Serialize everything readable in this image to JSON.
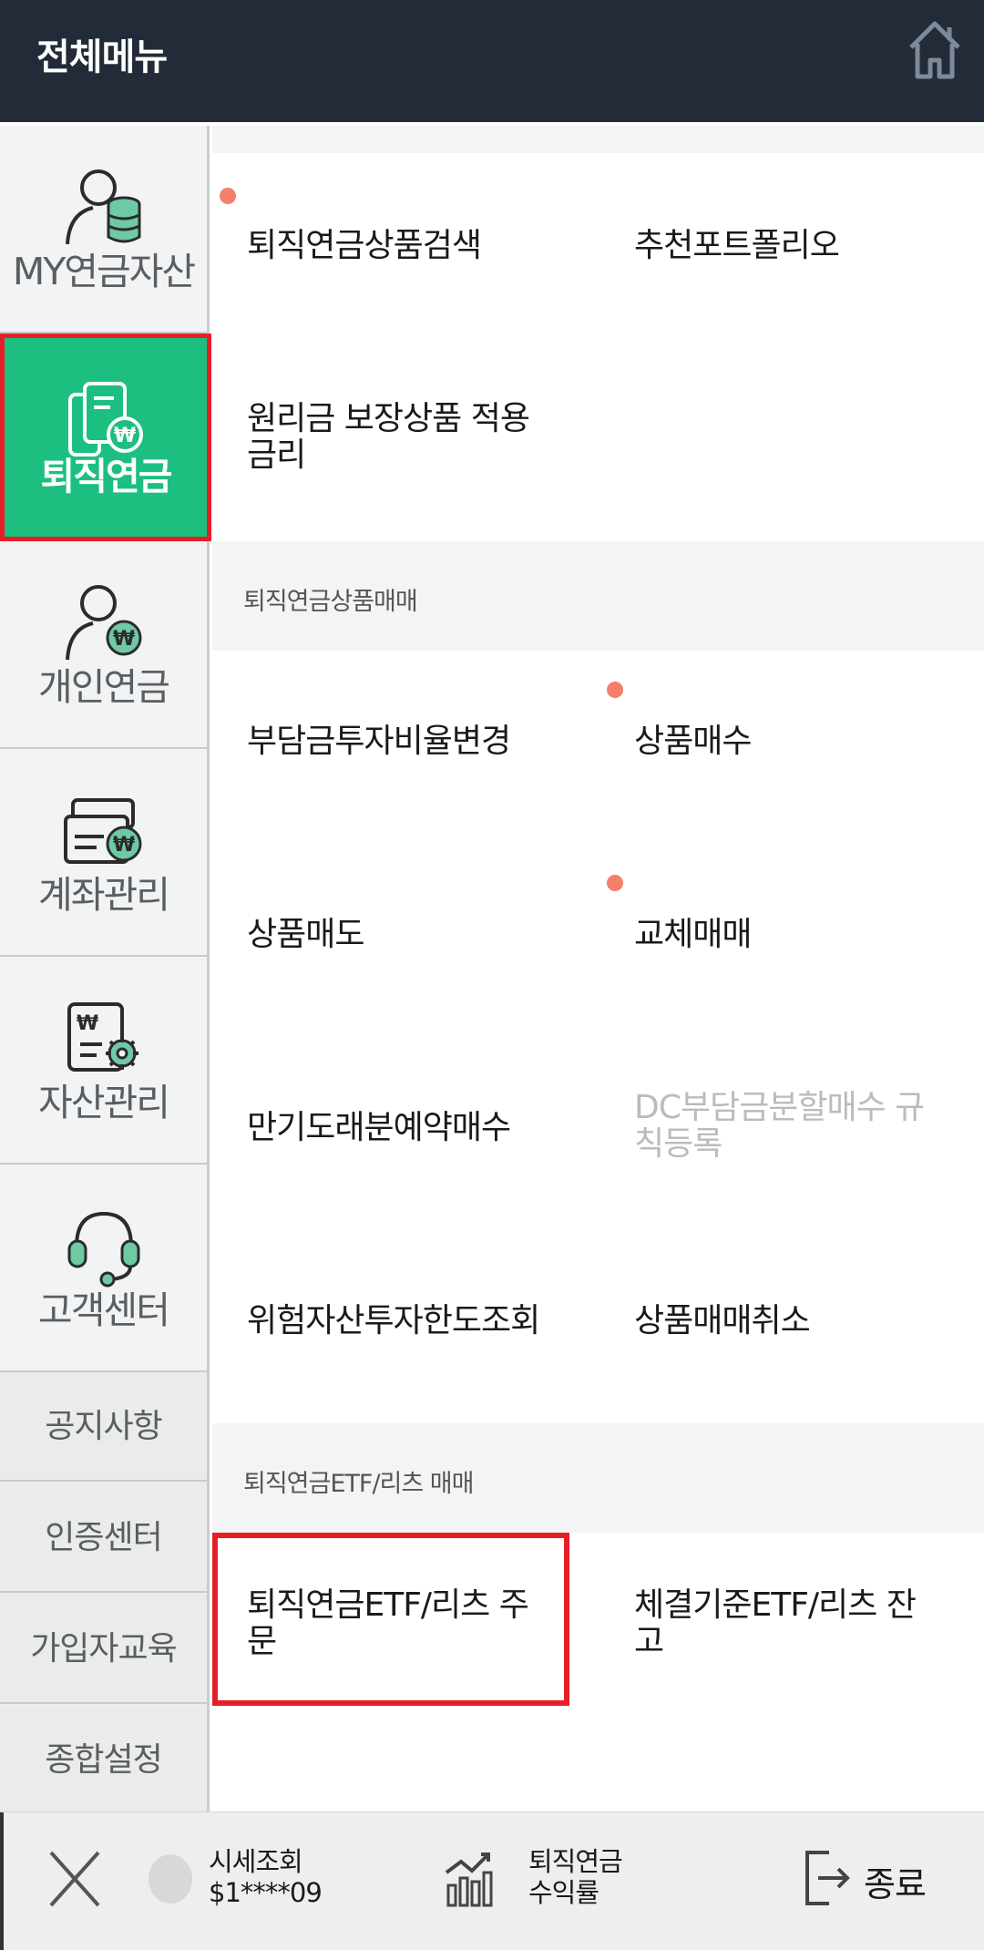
{
  "header": {
    "title": "전체메뉴",
    "home_icon": "home-icon"
  },
  "sidebar": {
    "items": [
      {
        "label": "MY연금자산",
        "icon": "person-coins-icon"
      },
      {
        "label": "퇴직연금",
        "icon": "document-won-icon",
        "active": true
      },
      {
        "label": "개인연금",
        "icon": "person-won-icon"
      },
      {
        "label": "계좌관리",
        "icon": "card-won-icon"
      },
      {
        "label": "자산관리",
        "icon": "document-gear-icon"
      },
      {
        "label": "고객센터",
        "icon": "headset-icon"
      }
    ],
    "subitems": [
      {
        "label": "공지사항"
      },
      {
        "label": "인증센터"
      },
      {
        "label": "가입자교육"
      },
      {
        "label": "종합설정"
      }
    ]
  },
  "content": {
    "top_items": [
      {
        "label": "퇴직연금상품검색"
      },
      {
        "label": "추천포트폴리오"
      },
      {
        "label": "원리금 보장상품 적용 금리"
      }
    ],
    "section1": {
      "title": "퇴직연금상품매매",
      "items": [
        {
          "label": "부담금투자비율변경"
        },
        {
          "label": "상품매수"
        },
        {
          "label": "상품매도"
        },
        {
          "label": "교체매매"
        },
        {
          "label": "만기도래분예약매수"
        },
        {
          "label": "DC부담금분할매수 규칙등록",
          "disabled": true
        },
        {
          "label": "위험자산투자한도조회"
        },
        {
          "label": "상품매매취소"
        }
      ]
    },
    "section2": {
      "title": "퇴직연금ETF/리츠 매매",
      "items": [
        {
          "label": "퇴직연금ETF/리츠 주문"
        },
        {
          "label": "체결기준ETF/리츠 잔고"
        }
      ]
    }
  },
  "bottom_bar": {
    "close_icon": "close-icon",
    "ticker_line1": "시세조회",
    "ticker_line2": "$1****09",
    "return_line1": "퇴직연금",
    "return_line2": "수익률",
    "exit_label": "종료"
  },
  "colors": {
    "header_bg": "#222b37",
    "active_green": "#1dbf80",
    "highlight_red": "#e61f27",
    "dot_salmon": "#f47f6b"
  }
}
